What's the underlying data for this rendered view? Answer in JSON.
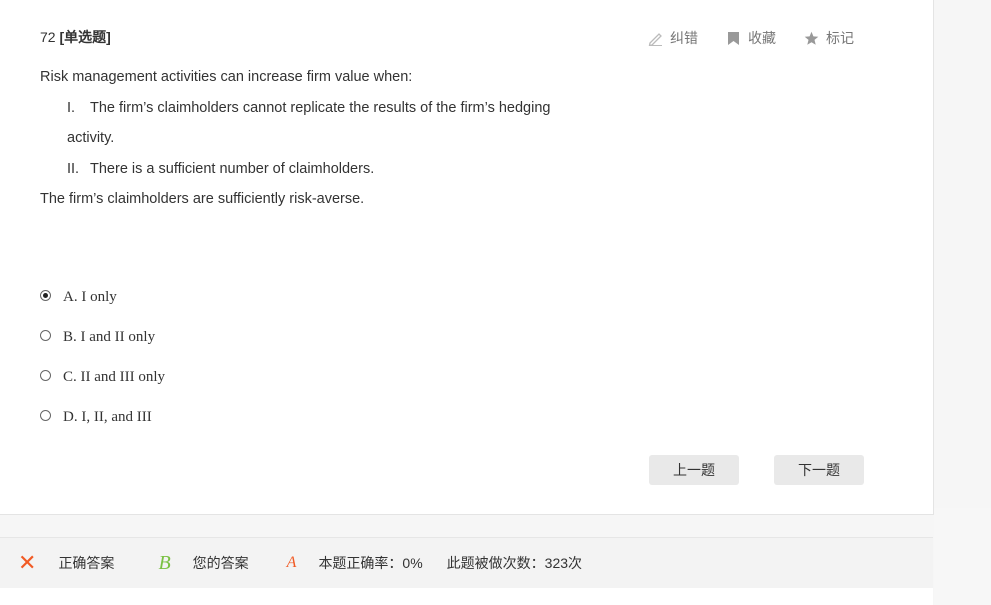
{
  "question": {
    "number": "72",
    "type_label": "[单选题]",
    "stem_intro": "Risk management activities can increase firm value when:",
    "items": [
      {
        "roman": "I.",
        "text": "The firm’s claimholders cannot replicate the results of the firm’s hedging",
        "cont": "activity."
      },
      {
        "roman": "II.",
        "text": "There is a sufficient number of claimholders."
      }
    ],
    "stem_tail": "The firm’s claimholders are sufficiently risk-averse."
  },
  "toolbar": {
    "correct_error": "纠错",
    "favorite": "收藏",
    "mark": "标记"
  },
  "options": [
    {
      "label": "A. I only",
      "selected": true
    },
    {
      "label": "B. I and II only",
      "selected": false
    },
    {
      "label": "C. II and III only",
      "selected": false
    },
    {
      "label": "D. I, II, and III",
      "selected": false
    }
  ],
  "nav": {
    "prev": "上一题",
    "next": "下一题"
  },
  "result": {
    "wrong_mark": "✕",
    "correct_answer_value": "B",
    "correct_answer_label": "正确答案",
    "your_answer_value": "A",
    "your_answer_label": "您的答案",
    "accuracy": "本题正确率：0%",
    "attempts": "此题被做次数：323次"
  },
  "colors": {
    "wrong": "#f15a24",
    "correct": "#7ac143"
  }
}
